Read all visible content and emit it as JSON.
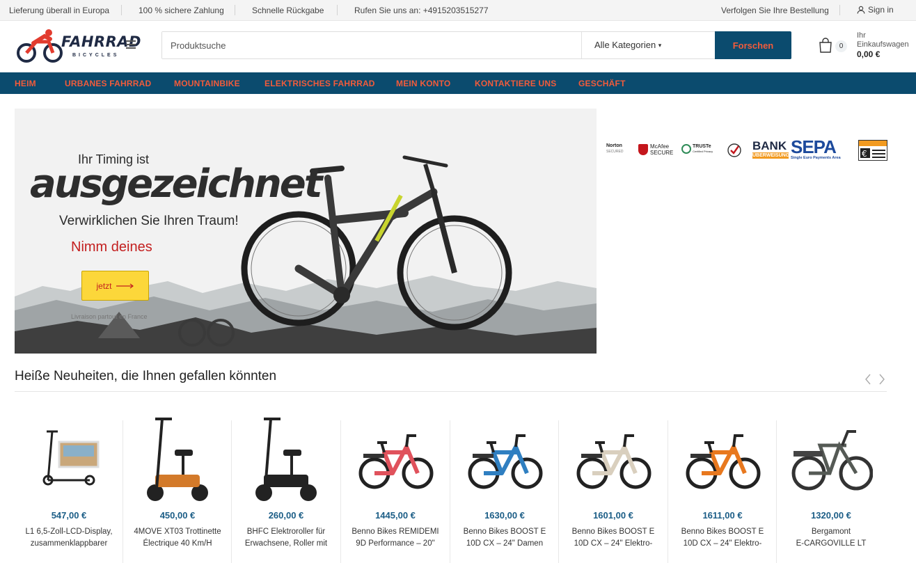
{
  "topbar": {
    "delivery": "Lieferung überall in Europa",
    "payment": "100 % sichere Zahlung",
    "returns": "Schnelle Rückgabe",
    "phone": "Rufen Sie uns an: +4915203515277",
    "track": "Verfolgen Sie Ihre Bestellung",
    "signin": "Sign in"
  },
  "logo": {
    "name": "FAHRRAD",
    "sub": "BICYCLES"
  },
  "search": {
    "placeholder": "Produktsuche",
    "category": "Alle Kategorien",
    "button": "Forschen"
  },
  "cart": {
    "count": "0",
    "label": "Ihr Einkaufswagen",
    "total": "0,00 €"
  },
  "nav": [
    "HEIM",
    "URBANES FAHRRAD",
    "MOUNTAINBIKE",
    "ELEKTRISCHES FAHRRAD",
    "MEIN KONTO",
    "KONTAKTIERE UNS",
    "GESCHÄFT"
  ],
  "hero": {
    "pre": "Ihr Timing ist",
    "title": "ausgezeichnet",
    "sub": "Verwirklichen Sie Ihren Traum!",
    "cta_text": "Nimm deines",
    "button": "jetzt",
    "note": "Livraison partout en France"
  },
  "trust": {
    "norton": "Norton",
    "norton_sub": "SECURED",
    "mcafee": "McAfee",
    "mcafee_sub": "SECURE",
    "truste": "TRUSTe",
    "truste_sub": "Certified Privacy",
    "bank": "BANK",
    "bank_sub": "ÜBERWEISUNG",
    "sepa": "SEPA",
    "sepa_sub": "Single Euro Payments Area"
  },
  "section": {
    "title": "Heiße Neuheiten, die Ihnen gefallen könnten"
  },
  "products": [
    {
      "price": "547,00 €",
      "name1": "L1 6,5-Zoll-LCD-Display,",
      "name2": "zusammenklappbarer",
      "kind": "scooter-screen",
      "color": "#222222"
    },
    {
      "price": "450,00 €",
      "name1": "4MOVE XT03 Trottinette",
      "name2": "Électrique 40 Km/H",
      "kind": "scooter-seat",
      "color": "#d37a2a"
    },
    {
      "price": "260,00 €",
      "name1": "BHFC Elektroroller für",
      "name2": "Erwachsene, Roller mit",
      "kind": "scooter-seat",
      "color": "#222222"
    },
    {
      "price": "1445,00 €",
      "name1": "Benno Bikes REMIDEMI",
      "name2": "9D Performance – 20\"",
      "kind": "ebike",
      "color": "#e0525c"
    },
    {
      "price": "1630,00 €",
      "name1": "Benno Bikes BOOST E",
      "name2": "10D CX – 24\" Damen",
      "kind": "ebike",
      "color": "#2f7fc1"
    },
    {
      "price": "1601,00 €",
      "name1": "Benno Bikes BOOST E",
      "name2": "10D CX – 24\" Elektro-",
      "kind": "ebike",
      "color": "#d9cfbe"
    },
    {
      "price": "1611,00 €",
      "name1": "Benno Bikes BOOST E",
      "name2": "10D CX – 24\" Elektro-",
      "kind": "ebike",
      "color": "#e8781e"
    },
    {
      "price": "1320,00 €",
      "name1": "Bergamont",
      "name2": "E-CARGOVILLE LT",
      "kind": "cargo",
      "color": "#555a55"
    }
  ]
}
